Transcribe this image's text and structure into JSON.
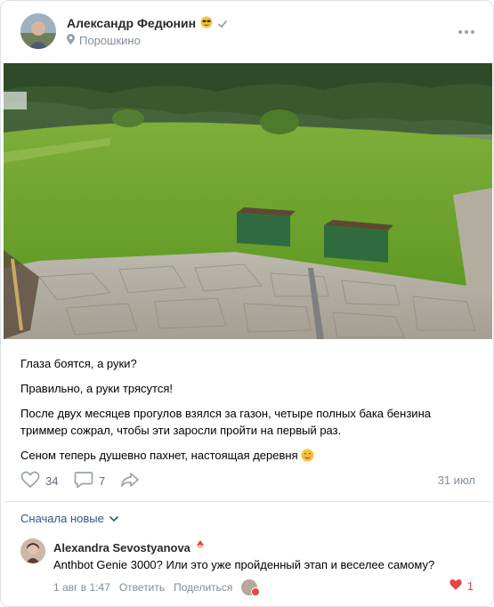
{
  "post": {
    "author": "Александр Федюнин",
    "author_badge_icon": "sunglasses-emoji-icon",
    "location": "Порошкино",
    "paragraphs": [
      "Глаза боятся, а руки?",
      "Правильно, а руки трясутся!",
      "После двух месяцев прогулов взялся за газон, четыре полных бака бензина триммер сожрал, чтобы эти заросли пройти на первый раз.",
      "Сеном теперь душевно пахнет, настоящая деревня"
    ],
    "likes": "34",
    "comments": "7",
    "date": "31 июл"
  },
  "comments_section": {
    "sort_label": "Сначала новые",
    "items": [
      {
        "author": "Alexandra Sevostyanova",
        "text": "Anthbot Genie 3000? Или это уже пройденный этап и веселее самому?",
        "time": "1 авг в 1:47",
        "reply_label": "Ответить",
        "share_label": "Поделиться",
        "likes": "1"
      }
    ]
  },
  "colors": {
    "link": "#2a5885",
    "muted": "#818c99",
    "like_red": "#e64646"
  }
}
